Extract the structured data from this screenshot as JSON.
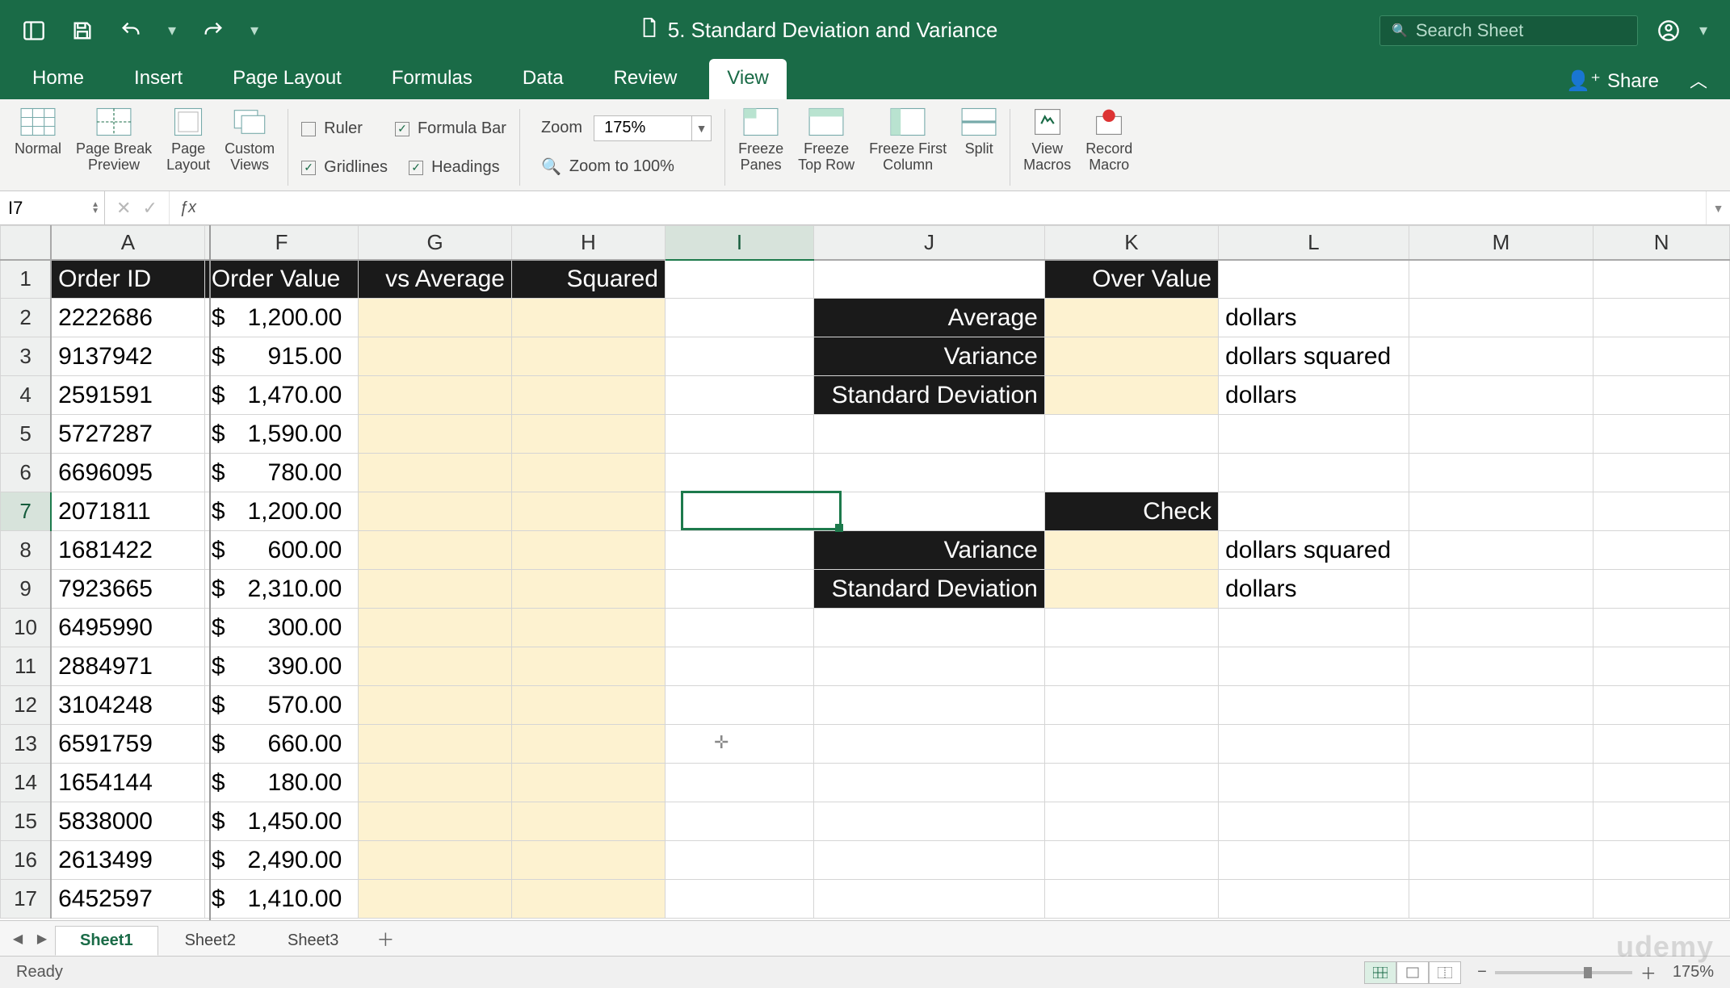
{
  "title": "5. Standard Deviation and Variance",
  "search_placeholder": "Search Sheet",
  "tabs": {
    "home": "Home",
    "insert": "Insert",
    "page_layout": "Page Layout",
    "formulas": "Formulas",
    "data": "Data",
    "review": "Review",
    "view": "View"
  },
  "share_label": "Share",
  "ribbon": {
    "normal": "Normal",
    "page_break": "Page Break\nPreview",
    "page_layout": "Page\nLayout",
    "custom_views": "Custom\nViews",
    "ruler": "Ruler",
    "formula_bar": "Formula Bar",
    "gridlines": "Gridlines",
    "headings": "Headings",
    "zoom_label": "Zoom",
    "zoom_value": "175%",
    "zoom_100": "Zoom to 100%",
    "freeze_panes": "Freeze\nPanes",
    "freeze_top": "Freeze\nTop Row",
    "freeze_first": "Freeze First\nColumn",
    "split": "Split",
    "view_macros": "View\nMacros",
    "record_macro": "Record\nMacro"
  },
  "namebox": "I7",
  "columns": [
    "A",
    "F",
    "G",
    "H",
    "I",
    "J",
    "K",
    "L",
    "M",
    "N"
  ],
  "active_col": "I",
  "active_row": 7,
  "headers": {
    "A": "Order ID",
    "F": "Order Value",
    "G": "vs Average",
    "H": "Squared",
    "K": "Over Value"
  },
  "stats": {
    "average_label": "Average",
    "variance_label": "Variance",
    "stddev_label": "Standard Deviation",
    "check_label": "Check",
    "dollars": "dollars",
    "dollars_sq": "dollars squared"
  },
  "rows": [
    {
      "r": 2,
      "id": "2222686",
      "val": "1,200.00"
    },
    {
      "r": 3,
      "id": "9137942",
      "val": "915.00"
    },
    {
      "r": 4,
      "id": "2591591",
      "val": "1,470.00"
    },
    {
      "r": 5,
      "id": "5727287",
      "val": "1,590.00"
    },
    {
      "r": 6,
      "id": "6696095",
      "val": "780.00"
    },
    {
      "r": 7,
      "id": "2071811",
      "val": "1,200.00"
    },
    {
      "r": 8,
      "id": "1681422",
      "val": "600.00"
    },
    {
      "r": 9,
      "id": "7923665",
      "val": "2,310.00"
    },
    {
      "r": 10,
      "id": "6495990",
      "val": "300.00"
    },
    {
      "r": 11,
      "id": "2884971",
      "val": "390.00"
    },
    {
      "r": 12,
      "id": "3104248",
      "val": "570.00"
    },
    {
      "r": 13,
      "id": "6591759",
      "val": "660.00"
    },
    {
      "r": 14,
      "id": "1654144",
      "val": "180.00"
    },
    {
      "r": 15,
      "id": "5838000",
      "val": "1,450.00"
    },
    {
      "r": 16,
      "id": "2613499",
      "val": "2,490.00"
    },
    {
      "r": 17,
      "id": "6452597",
      "val": "1,410.00"
    }
  ],
  "sheets": {
    "s1": "Sheet1",
    "s2": "Sheet2",
    "s3": "Sheet3"
  },
  "status": {
    "ready": "Ready",
    "zoom": "175%"
  },
  "watermark": "udemy"
}
